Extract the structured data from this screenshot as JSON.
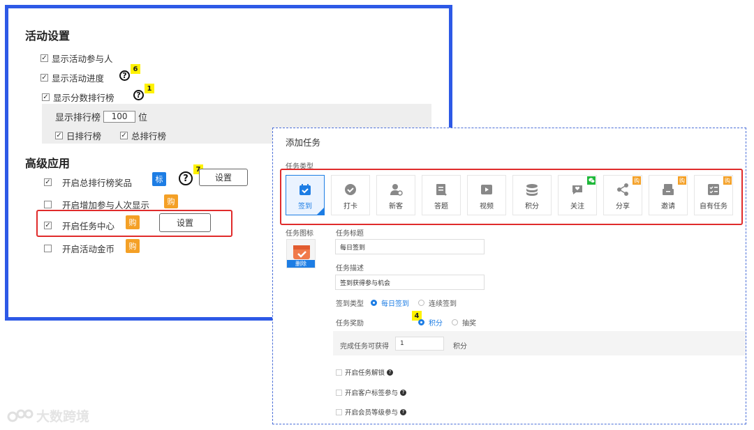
{
  "activity_settings": {
    "heading": "活动设置",
    "show_participants": "显示活动参与人",
    "show_progress": "显示活动进度",
    "show_ranking": "显示分数排行榜",
    "ranking_count_label": "显示排行榜",
    "ranking_count_value": "100",
    "ranking_count_unit": "位",
    "daily_ranking": "日排行榜",
    "total_ranking": "总排行榜",
    "check_mark": "✓"
  },
  "advanced": {
    "heading": "高级应用",
    "total_ranking_prize": "开启总排行榜奖品",
    "participants_display": "开启增加参与人次显示",
    "task_center": "开启任务中心",
    "activity_coins": "开启活动金币",
    "settings_button": "设置",
    "tag_biao": "标",
    "tag_buy": "购"
  },
  "badges": {
    "b6": "6",
    "b1": "1",
    "b7": "7",
    "b4": "4"
  },
  "question": "?",
  "dialog": {
    "title": "添加任务",
    "task_type_label": "任务类型",
    "types": [
      {
        "label": "签到",
        "icon": "calendar-icon",
        "badge": ""
      },
      {
        "label": "打卡",
        "icon": "clock-check-icon",
        "badge": ""
      },
      {
        "label": "新客",
        "icon": "new-user-icon",
        "badge": ""
      },
      {
        "label": "答题",
        "icon": "quiz-icon",
        "badge": ""
      },
      {
        "label": "视频",
        "icon": "video-icon",
        "badge": ""
      },
      {
        "label": "积分",
        "icon": "coins-icon",
        "badge": ""
      },
      {
        "label": "关注",
        "icon": "follow-icon",
        "badge": "wechat"
      },
      {
        "label": "分享",
        "icon": "share-icon",
        "badge": "购"
      },
      {
        "label": "邀请",
        "icon": "invite-icon",
        "badge": "购"
      },
      {
        "label": "自有任务",
        "icon": "custom-task-icon",
        "badge": "购"
      }
    ],
    "task_icon_label": "任务图标",
    "delete_label": "删除",
    "task_title_label": "任务标题",
    "task_title_value": "每日签到",
    "task_desc_label": "任务描述",
    "task_desc_value": "签到获得参与机会",
    "checkin_type_label": "签到类型",
    "checkin_daily": "每日签到",
    "checkin_continuous": "连续签到",
    "reward_label": "任务奖励",
    "reward_points": "积分",
    "reward_lottery": "抽奖",
    "complete_label": "完成任务可获得",
    "complete_value": "1",
    "complete_unit": "积分",
    "unlock": "开启任务解锁",
    "customer_tag": "开启客户标签参与",
    "member_level": "开启会员等级参与"
  },
  "watermark": "大数跨境",
  "colors": {
    "frame_blue": "#2d59e6",
    "accent_blue": "#1d7de4",
    "highlight_red": "#e02b2b",
    "buy_orange": "#f4a026",
    "badge_yellow": "#fff200"
  }
}
